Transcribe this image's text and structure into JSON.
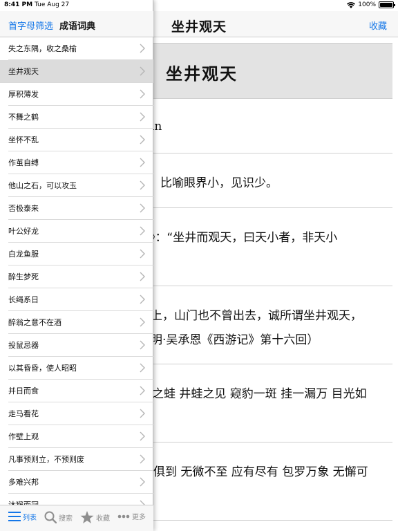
{
  "status": {
    "time": "8:41 PM",
    "date": "Tue Aug 27",
    "battery": "100%",
    "battery_level": 1.0
  },
  "sidebar": {
    "filter_label": "首字母筛选",
    "title": "成语词典",
    "items": [
      {
        "label": "失之东隅，收之桑榆"
      },
      {
        "label": "坐井观天"
      },
      {
        "label": "厚积薄发"
      },
      {
        "label": "不舞之鹤"
      },
      {
        "label": "坐怀不乱"
      },
      {
        "label": "作茧自缚"
      },
      {
        "label": "他山之石，可以攻玉"
      },
      {
        "label": "否极泰来"
      },
      {
        "label": "叶公好龙"
      },
      {
        "label": "白龙鱼服"
      },
      {
        "label": "醉生梦死"
      },
      {
        "label": "长绳系日"
      },
      {
        "label": "醉翁之意不在酒"
      },
      {
        "label": "投鼠忌器"
      },
      {
        "label": "以其昏昏，使人昭昭"
      },
      {
        "label": "并日而食"
      },
      {
        "label": "走马看花"
      },
      {
        "label": "作壁上观"
      },
      {
        "label": "凡事预则立，不预则废"
      },
      {
        "label": "多难兴邦"
      },
      {
        "label": "沐猴而冠"
      }
    ],
    "selected_index": 1
  },
  "tabbar": {
    "tabs": [
      {
        "label": "列表",
        "icon": "list-icon"
      },
      {
        "label": "搜索",
        "icon": "search-icon"
      },
      {
        "label": "收藏",
        "icon": "star-icon"
      },
      {
        "label": "更多",
        "icon": "more-icon"
      }
    ]
  },
  "detail": {
    "title": "坐井观天",
    "favorite_label": "收藏",
    "heading": "坐井观天",
    "pinyin_fragment": "in",
    "definition": "比喻眼界小，见识少。",
    "source": "》：“坐井而观天，曰天小者，非天小",
    "example_line1": "上，山门也不曾出去，诚所谓坐井观天，",
    "example_line2": "明·吴承恩《西游记》第十六回）",
    "synonyms": "之蛙 井蛙之见 窥豹一斑 挂一漏万 目光如",
    "antonyms": "俱到 无微不至 应有尽有 包罗万象 无懈可"
  },
  "colors": {
    "accent": "#1577e8",
    "selected_row": "#dcdcdc",
    "header_bg": "#e3e3e3",
    "nav_bg": "#f7f7f7"
  }
}
